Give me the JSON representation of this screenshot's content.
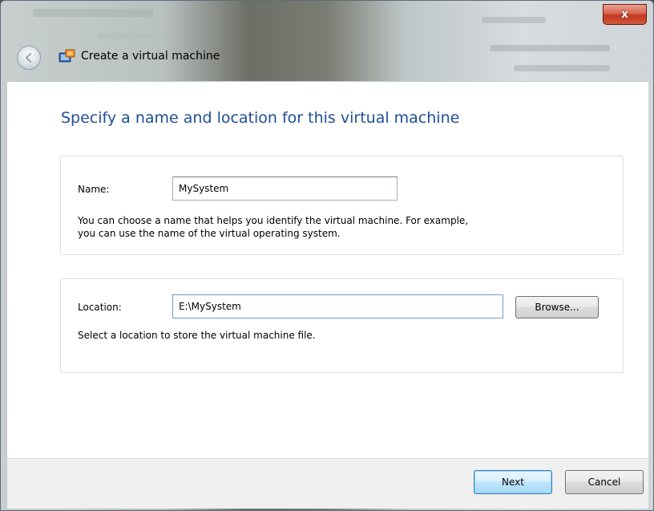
{
  "window": {
    "title": "Create a virtual machine",
    "close_glyph": "x"
  },
  "page": {
    "heading": "Specify a name and location for this virtual machine"
  },
  "name_group": {
    "label": "Name:",
    "value": "MySystem",
    "help": "You can choose a name that helps you identify the virtual machine. For example,\nyou can use the name of the virtual operating system."
  },
  "location_group": {
    "label": "Location:",
    "value": "E:\\MySystem",
    "browse_label": "Browse...",
    "help": "Select a location to store the virtual machine file."
  },
  "footer": {
    "next_label": "Next",
    "cancel_label": "Cancel"
  },
  "icons": {
    "back": "back-arrow-icon",
    "app": "virtual-machine-icon",
    "close": "close-icon"
  },
  "colors": {
    "heading": "#1f4e96",
    "close_button": "#c2371e",
    "primary_button_border": "#3c7fb1"
  }
}
